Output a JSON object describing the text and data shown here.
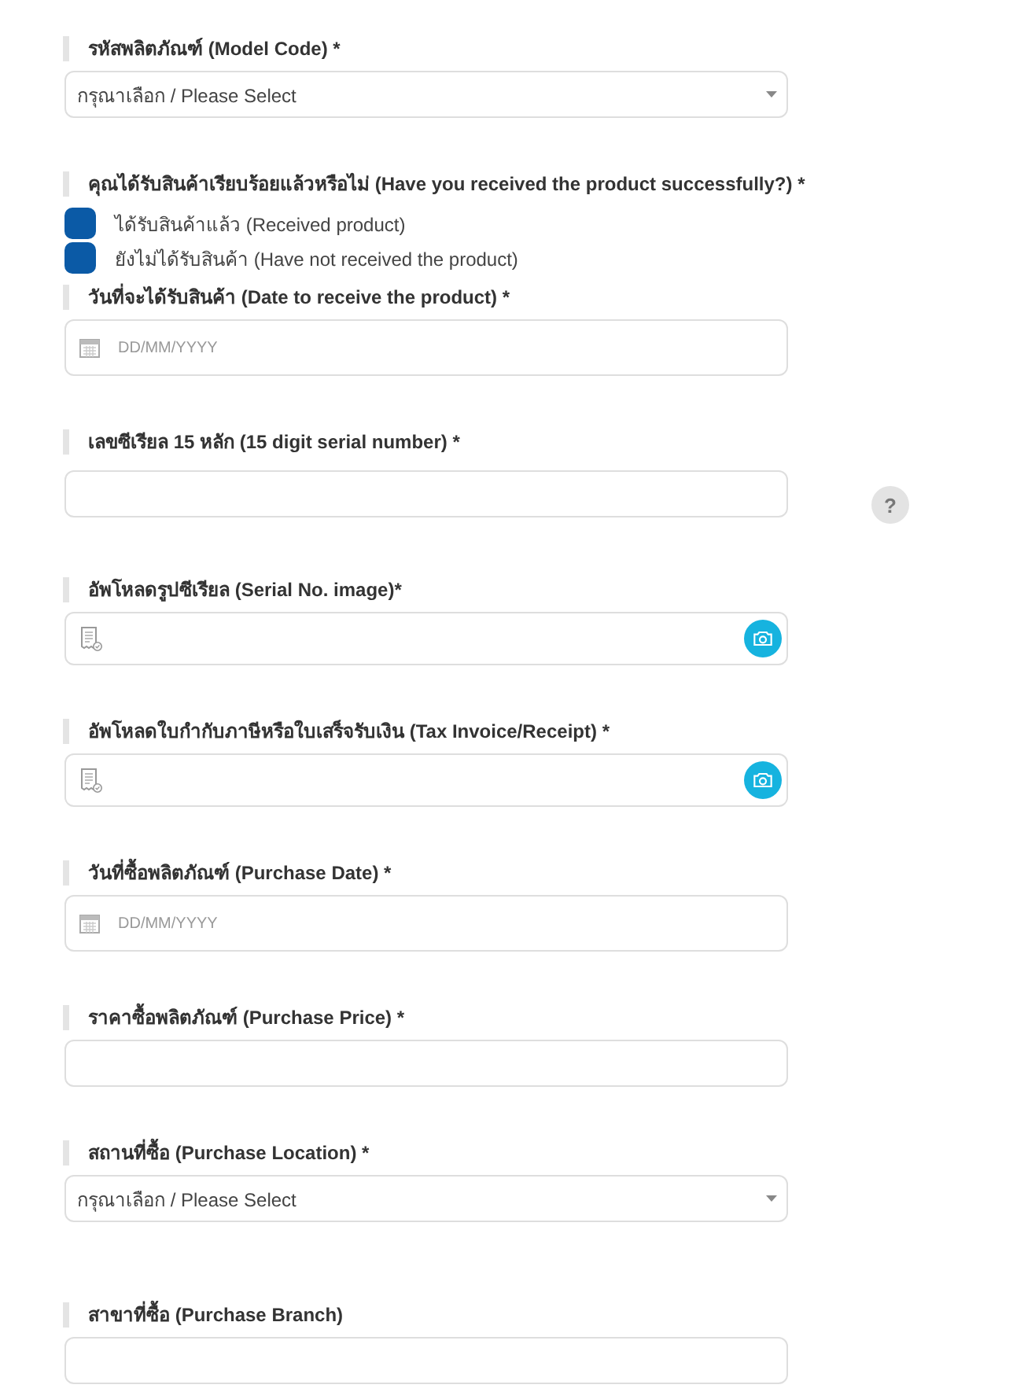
{
  "fields": [
    {
      "kind": "select",
      "label": "รหัสพลิตภัณฑ์ (Model Code) *",
      "value": "กรุณาเลือก / Please Select"
    },
    {
      "kind": "radio",
      "label": "คุณได้รับสินค้าเรียบร้อยแล้วหรือไม่ (Have you received the product successfully?) *",
      "options": [
        {
          "label": "ได้รับสินค้าแล้ว (Received product)",
          "selected": false
        },
        {
          "label": "ยังไม่ได้รับสินค้า (Have not received the product)",
          "selected": false
        }
      ]
    },
    {
      "kind": "date",
      "label": "วันที่จะได้รับสินค้า (Date to receive the product) *",
      "placeholder": "DD/MM/YYYY"
    },
    {
      "kind": "text",
      "label": "เลขซีเรียล 15 หลัก (15 digit serial number) *",
      "help": "?"
    },
    {
      "kind": "upload",
      "label": "อัพโหลดรูปซีเรียล (Serial No. image)*"
    },
    {
      "kind": "upload",
      "label": "อัพโหลดใบกำกับภาษีหรือใบเสร็จรับเงิน (Tax Invoice/Receipt) *"
    },
    {
      "kind": "date",
      "label": "วันที่ซื้อพลิตภัณฑ์ (Purchase Date) *",
      "placeholder": "DD/MM/YYYY"
    },
    {
      "kind": "text",
      "label": "ราคาซื้อพลิตภัณฑ์ (Purchase Price) *"
    },
    {
      "kind": "select",
      "label": "สถานที่ซื้อ (Purchase Location) *",
      "value": "กรุณาเลือก / Please Select"
    },
    {
      "kind": "text",
      "label": "สาขาที่ซื้อ (Purchase Branch)"
    }
  ]
}
